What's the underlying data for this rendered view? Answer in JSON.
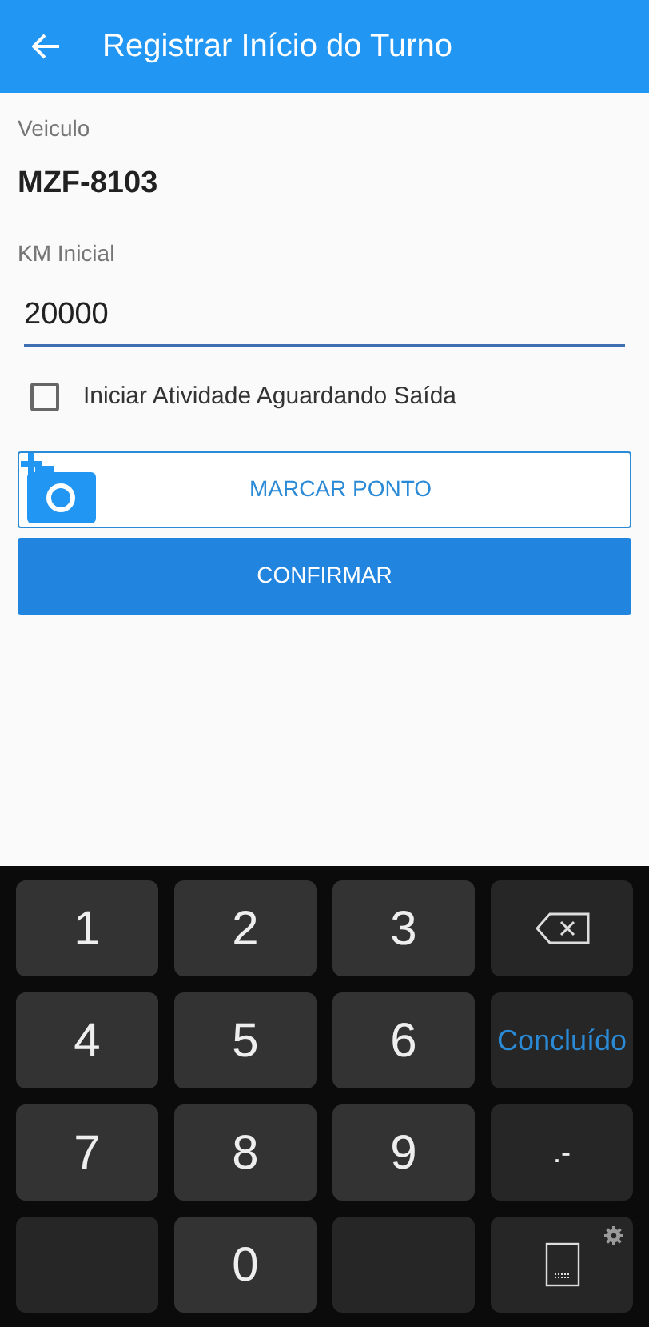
{
  "app_bar": {
    "title": "Registrar Início do Turno"
  },
  "vehicle": {
    "label": "Veiculo",
    "value": "MZF-8103"
  },
  "km": {
    "label": "KM Inicial",
    "value": "20000"
  },
  "checkbox": {
    "label": "Iniciar Atividade Aguardando Saída",
    "checked": false
  },
  "buttons": [
    {
      "kind": "outline",
      "label": "MARCAR PONTO"
    },
    {
      "kind": "primary",
      "label": "CONFIRMAR"
    }
  ],
  "keyboard": {
    "keys": [
      {
        "kind": "digit",
        "label": "1"
      },
      {
        "kind": "digit",
        "label": "2"
      },
      {
        "kind": "digit",
        "label": "3"
      },
      {
        "kind": "backspace"
      },
      {
        "kind": "digit",
        "label": "4"
      },
      {
        "kind": "digit",
        "label": "5"
      },
      {
        "kind": "digit",
        "label": "6"
      },
      {
        "kind": "done",
        "label": "Concluído"
      },
      {
        "kind": "digit",
        "label": "7"
      },
      {
        "kind": "digit",
        "label": "8"
      },
      {
        "kind": "digit",
        "label": "9"
      },
      {
        "kind": "symbol",
        "label": ".-"
      },
      {
        "kind": "blank"
      },
      {
        "kind": "digit",
        "label": "0"
      },
      {
        "kind": "blank"
      },
      {
        "kind": "keyboard"
      }
    ]
  }
}
